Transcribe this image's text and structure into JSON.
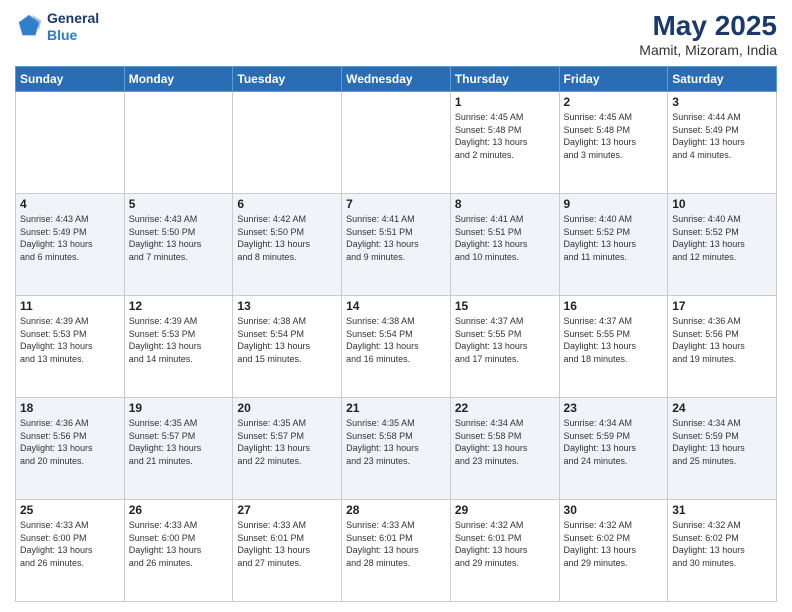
{
  "header": {
    "logo_line1": "General",
    "logo_line2": "Blue",
    "month_title": "May 2025",
    "subtitle": "Mamit, Mizoram, India"
  },
  "days_of_week": [
    "Sunday",
    "Monday",
    "Tuesday",
    "Wednesday",
    "Thursday",
    "Friday",
    "Saturday"
  ],
  "weeks": [
    [
      {
        "num": "",
        "info": ""
      },
      {
        "num": "",
        "info": ""
      },
      {
        "num": "",
        "info": ""
      },
      {
        "num": "",
        "info": ""
      },
      {
        "num": "1",
        "info": "Sunrise: 4:45 AM\nSunset: 5:48 PM\nDaylight: 13 hours\nand 2 minutes."
      },
      {
        "num": "2",
        "info": "Sunrise: 4:45 AM\nSunset: 5:48 PM\nDaylight: 13 hours\nand 3 minutes."
      },
      {
        "num": "3",
        "info": "Sunrise: 4:44 AM\nSunset: 5:49 PM\nDaylight: 13 hours\nand 4 minutes."
      }
    ],
    [
      {
        "num": "4",
        "info": "Sunrise: 4:43 AM\nSunset: 5:49 PM\nDaylight: 13 hours\nand 6 minutes."
      },
      {
        "num": "5",
        "info": "Sunrise: 4:43 AM\nSunset: 5:50 PM\nDaylight: 13 hours\nand 7 minutes."
      },
      {
        "num": "6",
        "info": "Sunrise: 4:42 AM\nSunset: 5:50 PM\nDaylight: 13 hours\nand 8 minutes."
      },
      {
        "num": "7",
        "info": "Sunrise: 4:41 AM\nSunset: 5:51 PM\nDaylight: 13 hours\nand 9 minutes."
      },
      {
        "num": "8",
        "info": "Sunrise: 4:41 AM\nSunset: 5:51 PM\nDaylight: 13 hours\nand 10 minutes."
      },
      {
        "num": "9",
        "info": "Sunrise: 4:40 AM\nSunset: 5:52 PM\nDaylight: 13 hours\nand 11 minutes."
      },
      {
        "num": "10",
        "info": "Sunrise: 4:40 AM\nSunset: 5:52 PM\nDaylight: 13 hours\nand 12 minutes."
      }
    ],
    [
      {
        "num": "11",
        "info": "Sunrise: 4:39 AM\nSunset: 5:53 PM\nDaylight: 13 hours\nand 13 minutes."
      },
      {
        "num": "12",
        "info": "Sunrise: 4:39 AM\nSunset: 5:53 PM\nDaylight: 13 hours\nand 14 minutes."
      },
      {
        "num": "13",
        "info": "Sunrise: 4:38 AM\nSunset: 5:54 PM\nDaylight: 13 hours\nand 15 minutes."
      },
      {
        "num": "14",
        "info": "Sunrise: 4:38 AM\nSunset: 5:54 PM\nDaylight: 13 hours\nand 16 minutes."
      },
      {
        "num": "15",
        "info": "Sunrise: 4:37 AM\nSunset: 5:55 PM\nDaylight: 13 hours\nand 17 minutes."
      },
      {
        "num": "16",
        "info": "Sunrise: 4:37 AM\nSunset: 5:55 PM\nDaylight: 13 hours\nand 18 minutes."
      },
      {
        "num": "17",
        "info": "Sunrise: 4:36 AM\nSunset: 5:56 PM\nDaylight: 13 hours\nand 19 minutes."
      }
    ],
    [
      {
        "num": "18",
        "info": "Sunrise: 4:36 AM\nSunset: 5:56 PM\nDaylight: 13 hours\nand 20 minutes."
      },
      {
        "num": "19",
        "info": "Sunrise: 4:35 AM\nSunset: 5:57 PM\nDaylight: 13 hours\nand 21 minutes."
      },
      {
        "num": "20",
        "info": "Sunrise: 4:35 AM\nSunset: 5:57 PM\nDaylight: 13 hours\nand 22 minutes."
      },
      {
        "num": "21",
        "info": "Sunrise: 4:35 AM\nSunset: 5:58 PM\nDaylight: 13 hours\nand 23 minutes."
      },
      {
        "num": "22",
        "info": "Sunrise: 4:34 AM\nSunset: 5:58 PM\nDaylight: 13 hours\nand 23 minutes."
      },
      {
        "num": "23",
        "info": "Sunrise: 4:34 AM\nSunset: 5:59 PM\nDaylight: 13 hours\nand 24 minutes."
      },
      {
        "num": "24",
        "info": "Sunrise: 4:34 AM\nSunset: 5:59 PM\nDaylight: 13 hours\nand 25 minutes."
      }
    ],
    [
      {
        "num": "25",
        "info": "Sunrise: 4:33 AM\nSunset: 6:00 PM\nDaylight: 13 hours\nand 26 minutes."
      },
      {
        "num": "26",
        "info": "Sunrise: 4:33 AM\nSunset: 6:00 PM\nDaylight: 13 hours\nand 26 minutes."
      },
      {
        "num": "27",
        "info": "Sunrise: 4:33 AM\nSunset: 6:01 PM\nDaylight: 13 hours\nand 27 minutes."
      },
      {
        "num": "28",
        "info": "Sunrise: 4:33 AM\nSunset: 6:01 PM\nDaylight: 13 hours\nand 28 minutes."
      },
      {
        "num": "29",
        "info": "Sunrise: 4:32 AM\nSunset: 6:01 PM\nDaylight: 13 hours\nand 29 minutes."
      },
      {
        "num": "30",
        "info": "Sunrise: 4:32 AM\nSunset: 6:02 PM\nDaylight: 13 hours\nand 29 minutes."
      },
      {
        "num": "31",
        "info": "Sunrise: 4:32 AM\nSunset: 6:02 PM\nDaylight: 13 hours\nand 30 minutes."
      }
    ]
  ]
}
